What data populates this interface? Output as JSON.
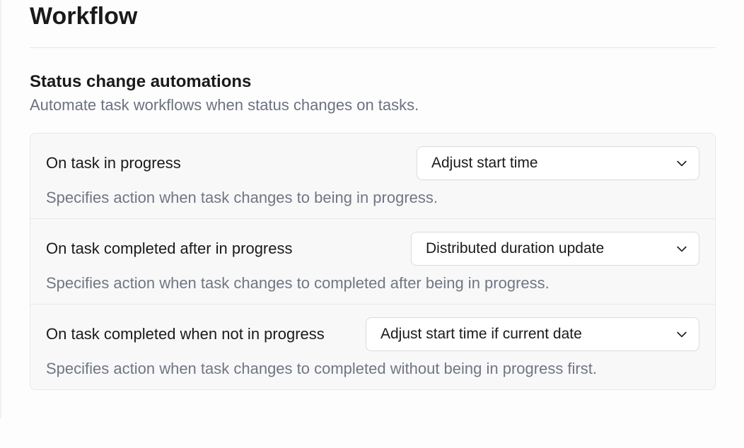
{
  "page": {
    "title": "Workflow"
  },
  "section": {
    "title": "Status change automations",
    "subtitle": "Automate task workflows when status changes on tasks."
  },
  "automations": [
    {
      "label": "On task in progress",
      "selected": "Adjust start time",
      "description": "Specifies action when task changes to being in progress."
    },
    {
      "label": "On task completed after in progress",
      "selected": "Distributed duration update",
      "description": "Specifies action when task changes to completed after being in progress."
    },
    {
      "label": "On task completed when not in progress",
      "selected": "Adjust start time if current date",
      "description": "Specifies action when task changes to completed without being in progress first."
    }
  ]
}
